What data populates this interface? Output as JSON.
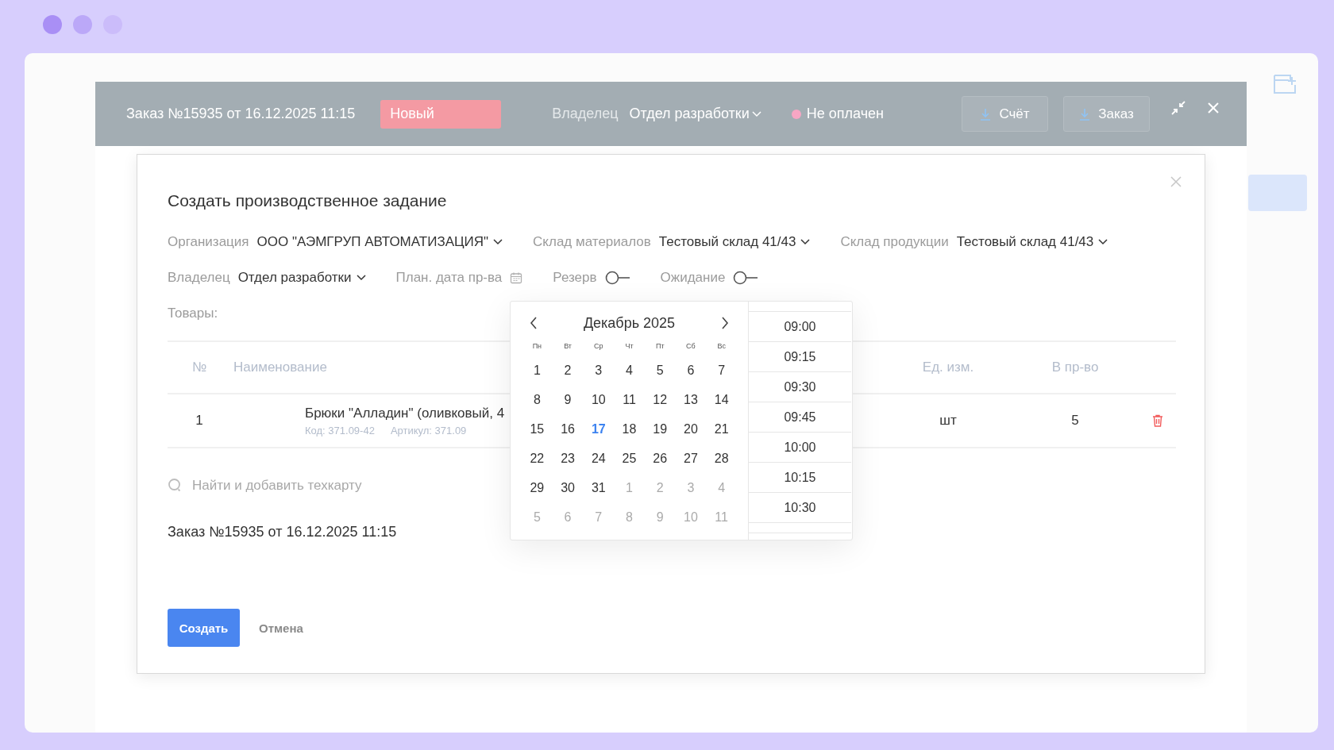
{
  "order": {
    "title": "Заказ №15935 от 16.12.2025 11:15",
    "status": {
      "label": "Новый",
      "color": "#f49aa3"
    },
    "owner_label": "Владелец",
    "owner_value": "Отдел разработки",
    "payment": {
      "label": "Не оплачен",
      "color": "#f7a6c4"
    },
    "buttons": [
      "Счёт",
      "Заказ"
    ]
  },
  "dialog": {
    "title": "Создать производственное задание",
    "field_rows": [
      [
        {
          "kind": "select",
          "label": "Организация",
          "value": "ООО \"АЭМГРУП АВТОМАТИЗАЦИЯ\""
        },
        {
          "kind": "select",
          "label": "Склад материалов",
          "value": "Тестовый склад 41/43"
        },
        {
          "kind": "select",
          "label": "Склад продукции",
          "value": "Тестовый склад 41/43"
        }
      ],
      [
        {
          "kind": "select",
          "label": "Владелец",
          "value": "Отдел разработки"
        },
        {
          "kind": "date",
          "label": "План. дата пр-ва"
        },
        {
          "kind": "toggle",
          "label": "Резерв",
          "on": false
        },
        {
          "kind": "toggle",
          "label": "Ожидание",
          "on": false
        }
      ]
    ],
    "products_label": "Товары:",
    "columns": [
      "№",
      "Наименование",
      "Ед. изм.",
      "В пр-во"
    ],
    "rows": [
      {
        "number": "1",
        "name": "Брюки \"Алладин\" (оливковый, 4",
        "code": "Код: 371.09-42",
        "article": "Артикул: 371.09",
        "unit": "шт",
        "quantity": "5"
      }
    ],
    "search": {
      "placeholder": "Найти и добавить техкарту"
    },
    "order_reference": "Заказ №15935 от 16.12.2025 11:15",
    "buttons": [
      {
        "kind": "primary",
        "label": "Создать"
      },
      {
        "kind": "link",
        "label": "Отмена"
      }
    ]
  },
  "datepicker": {
    "month": "Декабрь 2025",
    "weekdays": [
      "Пн",
      "Вт",
      "Ср",
      "Чт",
      "Пт",
      "Сб",
      "Вс"
    ],
    "days": [
      {
        "label": "1",
        "other_month": false,
        "selected": false
      },
      {
        "label": "2",
        "other_month": false,
        "selected": false
      },
      {
        "label": "3",
        "other_month": false,
        "selected": false
      },
      {
        "label": "4",
        "other_month": false,
        "selected": false
      },
      {
        "label": "5",
        "other_month": false,
        "selected": false
      },
      {
        "label": "6",
        "other_month": false,
        "selected": false
      },
      {
        "label": "7",
        "other_month": false,
        "selected": false
      },
      {
        "label": "8",
        "other_month": false,
        "selected": false
      },
      {
        "label": "9",
        "other_month": false,
        "selected": false
      },
      {
        "label": "10",
        "other_month": false,
        "selected": false
      },
      {
        "label": "11",
        "other_month": false,
        "selected": false
      },
      {
        "label": "12",
        "other_month": false,
        "selected": false
      },
      {
        "label": "13",
        "other_month": false,
        "selected": false
      },
      {
        "label": "14",
        "other_month": false,
        "selected": false
      },
      {
        "label": "15",
        "other_month": false,
        "selected": false
      },
      {
        "label": "16",
        "other_month": false,
        "selected": false
      },
      {
        "label": "17",
        "other_month": false,
        "selected": true
      },
      {
        "label": "18",
        "other_month": false,
        "selected": false
      },
      {
        "label": "19",
        "other_month": false,
        "selected": false
      },
      {
        "label": "20",
        "other_month": false,
        "selected": false
      },
      {
        "label": "21",
        "other_month": false,
        "selected": false
      },
      {
        "label": "22",
        "other_month": false,
        "selected": false
      },
      {
        "label": "23",
        "other_month": false,
        "selected": false
      },
      {
        "label": "24",
        "other_month": false,
        "selected": false
      },
      {
        "label": "25",
        "other_month": false,
        "selected": false
      },
      {
        "label": "26",
        "other_month": false,
        "selected": false
      },
      {
        "label": "27",
        "other_month": false,
        "selected": false
      },
      {
        "label": "28",
        "other_month": false,
        "selected": false
      },
      {
        "label": "29",
        "other_month": false,
        "selected": false
      },
      {
        "label": "30",
        "other_month": false,
        "selected": false
      },
      {
        "label": "31",
        "other_month": false,
        "selected": false
      },
      {
        "label": "1",
        "other_month": true,
        "selected": false
      },
      {
        "label": "2",
        "other_month": true,
        "selected": false
      },
      {
        "label": "3",
        "other_month": true,
        "selected": false
      },
      {
        "label": "4",
        "other_month": true,
        "selected": false
      },
      {
        "label": "5",
        "other_month": true,
        "selected": false
      },
      {
        "label": "6",
        "other_month": true,
        "selected": false
      },
      {
        "label": "7",
        "other_month": true,
        "selected": false
      },
      {
        "label": "8",
        "other_month": true,
        "selected": false
      },
      {
        "label": "9",
        "other_month": true,
        "selected": false
      },
      {
        "label": "10",
        "other_month": true,
        "selected": false
      },
      {
        "label": "11",
        "other_month": true,
        "selected": false
      }
    ],
    "times": [
      "09:00",
      "09:15",
      "09:30",
      "09:45",
      "10:00",
      "10:15",
      "10:30"
    ]
  }
}
